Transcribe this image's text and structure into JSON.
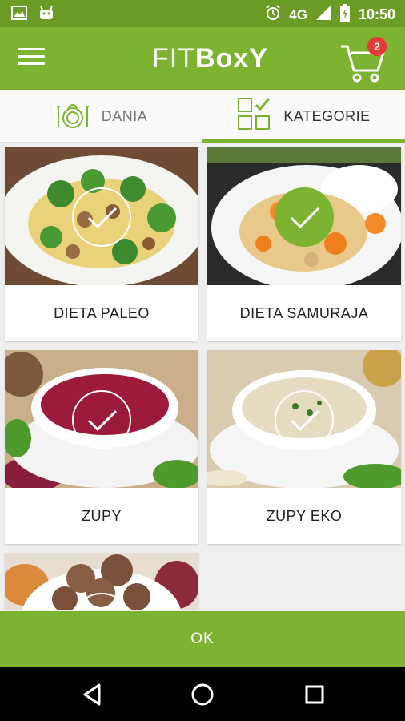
{
  "status_bar": {
    "network": "4G",
    "time": "10:50",
    "icons": [
      "image-icon",
      "android-icon",
      "alarm-icon",
      "signal-icon",
      "battery-icon"
    ]
  },
  "app_bar": {
    "logo_thin": "FIT",
    "logo_bold": "BoxY",
    "cart_count": "2",
    "icons": [
      "menu-icon",
      "cart-icon"
    ]
  },
  "tabs": [
    {
      "label": "DANIA",
      "icon": "plate-icon",
      "active": false
    },
    {
      "label": "KATEGORIE",
      "icon": "categories-grid-icon",
      "active": true
    }
  ],
  "categories": [
    {
      "label": "DIETA PALEO",
      "selected": false
    },
    {
      "label": "DIETA SAMURAJA",
      "selected": true
    },
    {
      "label": "ZUPY",
      "selected": false
    },
    {
      "label": "ZUPY EKO",
      "selected": false
    },
    {
      "label": "",
      "selected": false
    }
  ],
  "ok_button": {
    "label": "OK"
  },
  "colors": {
    "primary": "#7cb431",
    "status_bar": "#6a9c26",
    "badge": "#e53935",
    "background": "#efefef"
  },
  "nav_bar": {
    "icons": [
      "back-icon",
      "home-icon",
      "recents-icon"
    ]
  }
}
